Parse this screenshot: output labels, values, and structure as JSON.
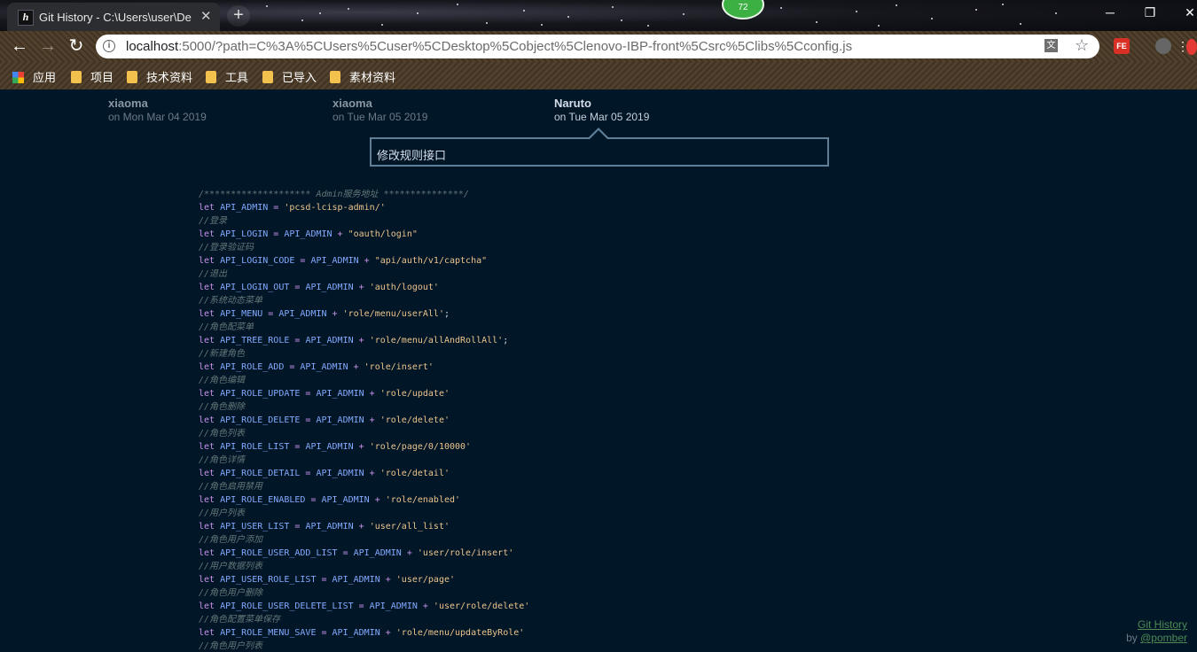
{
  "browser": {
    "tab_title": "Git History - C:\\Users\\user\\De",
    "tab_close": "✕",
    "new_tab": "+",
    "badge": "72",
    "url_host": "localhost",
    "url_rest": ":5000/?path=C%3A%5CUsers%5Cuser%5CDesktop%5Cobject%5Clenovo-IBP-front%5Csrc%5Clibs%5Cconfig.js",
    "extension_fe": "FE",
    "bookmarks": [
      {
        "label": "应用",
        "icon": "apps-grid-icon"
      },
      {
        "label": "项目",
        "icon": "folder-icon"
      },
      {
        "label": "技术资料",
        "icon": "folder-icon"
      },
      {
        "label": "工具",
        "icon": "folder-icon"
      },
      {
        "label": "已导入",
        "icon": "folder-icon"
      },
      {
        "label": "素材资料",
        "icon": "folder-icon"
      }
    ]
  },
  "commits": [
    {
      "author": "xiaoma",
      "date": "on Mon Mar 04 2019"
    },
    {
      "author": "xiaoma",
      "date": "on Tue Mar 05 2019"
    },
    {
      "author": "Naruto",
      "date": "on Tue Mar 05 2019"
    }
  ],
  "commit_message": "修改规则接口",
  "code_lines": [
    [
      [
        "comment",
        "/******************** Admin服务地址 ***************/"
      ]
    ],
    [
      [
        "keyword",
        "let "
      ],
      [
        "ident",
        "API_ADMIN"
      ],
      [
        "op",
        " = "
      ],
      [
        "str",
        "'pcsd-lcisp-admin/'"
      ]
    ],
    [
      [
        "comment",
        "//登录"
      ]
    ],
    [
      [
        "keyword",
        "let "
      ],
      [
        "ident",
        "API_LOGIN"
      ],
      [
        "op",
        " = "
      ],
      [
        "ident",
        "API_ADMIN"
      ],
      [
        "op",
        " + "
      ],
      [
        "str",
        "\"oauth/login\""
      ]
    ],
    [
      [
        "comment",
        "//登录验证码"
      ]
    ],
    [
      [
        "keyword",
        "let "
      ],
      [
        "ident",
        "API_LOGIN_CODE"
      ],
      [
        "op",
        " = "
      ],
      [
        "ident",
        "API_ADMIN"
      ],
      [
        "op",
        " + "
      ],
      [
        "str",
        "\"api/auth/v1/captcha\""
      ]
    ],
    [
      [
        "comment",
        "//退出"
      ]
    ],
    [
      [
        "keyword",
        "let "
      ],
      [
        "ident",
        "API_LOGIN_OUT"
      ],
      [
        "op",
        " = "
      ],
      [
        "ident",
        "API_ADMIN"
      ],
      [
        "op",
        " + "
      ],
      [
        "str",
        "'auth/logout'"
      ]
    ],
    [
      [
        "comment",
        "//系统动态菜单"
      ]
    ],
    [
      [
        "keyword",
        "let "
      ],
      [
        "ident",
        "API_MENU"
      ],
      [
        "op",
        " = "
      ],
      [
        "ident",
        "API_ADMIN"
      ],
      [
        "op",
        " + "
      ],
      [
        "str",
        "'role/menu/userAll'"
      ],
      [
        "punct",
        ";"
      ]
    ],
    [
      [
        "comment",
        "//角色配菜单"
      ]
    ],
    [
      [
        "keyword",
        "let "
      ],
      [
        "ident",
        "API_TREE_ROLE"
      ],
      [
        "op",
        " = "
      ],
      [
        "ident",
        "API_ADMIN"
      ],
      [
        "op",
        " + "
      ],
      [
        "str",
        "'role/menu/allAndRollAll'"
      ],
      [
        "punct",
        ";"
      ]
    ],
    [
      [
        "comment",
        "//新建角色"
      ]
    ],
    [
      [
        "keyword",
        "let "
      ],
      [
        "ident",
        "API_ROLE_ADD"
      ],
      [
        "op",
        " = "
      ],
      [
        "ident",
        "API_ADMIN"
      ],
      [
        "op",
        " + "
      ],
      [
        "str",
        "'role/insert'"
      ]
    ],
    [
      [
        "comment",
        "//角色编辑"
      ]
    ],
    [
      [
        "keyword",
        "let "
      ],
      [
        "ident",
        "API_ROLE_UPDATE"
      ],
      [
        "op",
        " = "
      ],
      [
        "ident",
        "API_ADMIN"
      ],
      [
        "op",
        " + "
      ],
      [
        "str",
        "'role/update'"
      ]
    ],
    [
      [
        "comment",
        "//角色删除"
      ]
    ],
    [
      [
        "keyword",
        "let "
      ],
      [
        "ident",
        "API_ROLE_DELETE"
      ],
      [
        "op",
        " = "
      ],
      [
        "ident",
        "API_ADMIN"
      ],
      [
        "op",
        " + "
      ],
      [
        "str",
        "'role/delete'"
      ]
    ],
    [
      [
        "comment",
        "//角色列表"
      ]
    ],
    [
      [
        "keyword",
        "let "
      ],
      [
        "ident",
        "API_ROLE_LIST"
      ],
      [
        "op",
        " = "
      ],
      [
        "ident",
        "API_ADMIN"
      ],
      [
        "op",
        " + "
      ],
      [
        "str",
        "'role/page/0/10000'"
      ]
    ],
    [
      [
        "comment",
        "//角色详情"
      ]
    ],
    [
      [
        "keyword",
        "let "
      ],
      [
        "ident",
        "API_ROLE_DETAIL"
      ],
      [
        "op",
        " = "
      ],
      [
        "ident",
        "API_ADMIN"
      ],
      [
        "op",
        " + "
      ],
      [
        "str",
        "'role/detail'"
      ]
    ],
    [
      [
        "comment",
        "//角色启用禁用"
      ]
    ],
    [
      [
        "keyword",
        "let "
      ],
      [
        "ident",
        "API_ROLE_ENABLED"
      ],
      [
        "op",
        " = "
      ],
      [
        "ident",
        "API_ADMIN"
      ],
      [
        "op",
        " + "
      ],
      [
        "str",
        "'role/enabled'"
      ]
    ],
    [
      [
        "comment",
        "//用户列表"
      ]
    ],
    [
      [
        "keyword",
        "let "
      ],
      [
        "ident",
        "API_USER_LIST"
      ],
      [
        "op",
        " = "
      ],
      [
        "ident",
        "API_ADMIN"
      ],
      [
        "op",
        " + "
      ],
      [
        "str",
        "'user/all_list'"
      ]
    ],
    [
      [
        "comment",
        "//角色用户添加"
      ]
    ],
    [
      [
        "keyword",
        "let "
      ],
      [
        "ident",
        "API_ROLE_USER_ADD_LIST"
      ],
      [
        "op",
        " = "
      ],
      [
        "ident",
        "API_ADMIN"
      ],
      [
        "op",
        " + "
      ],
      [
        "str",
        "'user/role/insert'"
      ]
    ],
    [
      [
        "comment",
        "//用户数据列表"
      ]
    ],
    [
      [
        "keyword",
        "let "
      ],
      [
        "ident",
        "API_USER_ROLE_LIST"
      ],
      [
        "op",
        " = "
      ],
      [
        "ident",
        "API_ADMIN"
      ],
      [
        "op",
        " + "
      ],
      [
        "str",
        "'user/page'"
      ]
    ],
    [
      [
        "comment",
        "//角色用户删除"
      ]
    ],
    [
      [
        "keyword",
        "let "
      ],
      [
        "ident",
        "API_ROLE_USER_DELETE_LIST"
      ],
      [
        "op",
        " = "
      ],
      [
        "ident",
        "API_ADMIN"
      ],
      [
        "op",
        " + "
      ],
      [
        "str",
        "'user/role/delete'"
      ]
    ],
    [
      [
        "comment",
        "//角色配置菜单保存"
      ]
    ],
    [
      [
        "keyword",
        "let "
      ],
      [
        "ident",
        "API_ROLE_MENU_SAVE"
      ],
      [
        "op",
        " = "
      ],
      [
        "ident",
        "API_ADMIN"
      ],
      [
        "op",
        " + "
      ],
      [
        "str",
        "'role/menu/updateByRole'"
      ]
    ],
    [
      [
        "comment",
        "//角色用户列表"
      ]
    ]
  ],
  "footer": {
    "title": "Git History",
    "by": "by ",
    "author": "@pomber"
  },
  "colors": {
    "background": "#011627",
    "comment": "#637777",
    "keyword": "#c792ea",
    "identifier": "#82aaff",
    "string": "#ecc48d"
  }
}
